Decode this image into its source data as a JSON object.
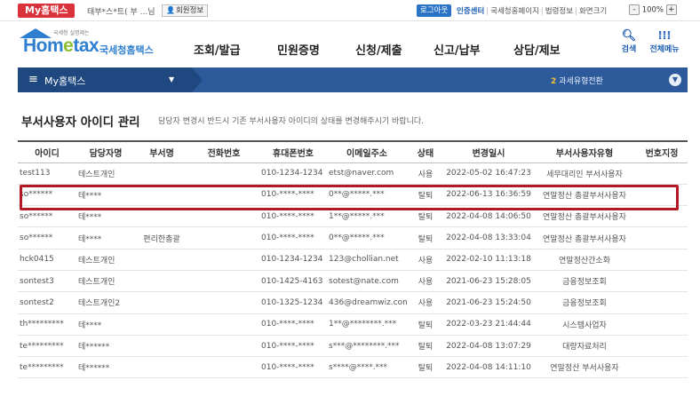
{
  "topbar": {
    "my_badge": "My홈택스",
    "username": "태부*스*트( 부 ...님",
    "profile_button": "회원정보",
    "logout_button": "로그아웃",
    "links": [
      "인증센터",
      "국세청홈페이지",
      "법령정보",
      "화면크기"
    ],
    "zoom": {
      "minus": "-",
      "value": "100%",
      "plus": "+"
    }
  },
  "logo": {
    "tagline": "국세청 실명제는",
    "wordmark_pre": "Hom",
    "wordmark_e": "e",
    "wordmark_post": "tax",
    "subtitle": "국세청홈택스"
  },
  "nav": {
    "menu": [
      "조회/발급",
      "민원증명",
      "신청/제출",
      "신고/납부",
      "상담/제보"
    ],
    "search_label": "검색",
    "allmenu_label": "전체메뉴"
  },
  "bluebar": {
    "title": "My홈택스",
    "switch_num": "2",
    "switch_label": "과세유형전환"
  },
  "page": {
    "title": "부서사용자 아이디 관리",
    "note": "담당자 변경시 반드시 기존 부서사용자 아이디의 상태를 변경해주시기 바랍니다."
  },
  "table": {
    "headers": [
      "아이디",
      "담당자명",
      "부서명",
      "전화번호",
      "휴대폰번호",
      "이메일주소",
      "상태",
      "변경일시",
      "부서사용자유형",
      "번호지정"
    ],
    "rows": [
      [
        "test113",
        "테스트개인",
        "",
        "",
        "010-1234-1234",
        "etst@naver.com",
        "사용",
        "2022-05-02 16:47:23",
        "세무대리인 부서사용자",
        ""
      ],
      [
        "so******",
        "테****",
        "",
        "",
        "010-****-****",
        "0**@*****.***",
        "탈퇴",
        "2022-06-13 16:36:59",
        "연말정산 총괄부서사용자",
        ""
      ],
      [
        "so******",
        "테****",
        "",
        "",
        "010-****-****",
        "1**@*****.***",
        "탈퇴",
        "2022-04-08 14:06:50",
        "연말정산 총괄부서사용자",
        ""
      ],
      [
        "so******",
        "테****",
        "편리한총괄",
        "",
        "010-****-****",
        "0**@*****.***",
        "탈퇴",
        "2022-04-08 13:33:04",
        "연말정산 총괄부서사용자",
        ""
      ],
      [
        "hck0415",
        "테스트개인",
        "",
        "",
        "010-1234-1234",
        "123@chollian.net",
        "사용",
        "2022-02-10 11:13:18",
        "연말정산간소화",
        ""
      ],
      [
        "sontest3",
        "테스트개인",
        "",
        "",
        "010-1425-4163",
        "sotest@nate.com",
        "사용",
        "2021-06-23 15:28:05",
        "금융정보조회",
        ""
      ],
      [
        "sontest2",
        "테스트개인2",
        "",
        "",
        "010-1325-1234",
        "436@dreamwiz.com",
        "사용",
        "2021-06-23 15:24:50",
        "금융정보조회",
        ""
      ],
      [
        "th*********",
        "테****",
        "",
        "",
        "010-****-****",
        "1**@********.***",
        "탈퇴",
        "2022-03-23 21:44:44",
        "시스템사업자",
        ""
      ],
      [
        "te*********",
        "테******",
        "",
        "",
        "010-****-****",
        "s***@********.***",
        "탈퇴",
        "2022-04-08 13:07:29",
        "대량자료처리",
        ""
      ],
      [
        "te*********",
        "테******",
        "",
        "",
        "010-****-****",
        "s****@****.***",
        "탈퇴",
        "2022-04-08 14:11:10",
        "연말정산 부서사용자",
        ""
      ]
    ]
  },
  "colors": {
    "brand_red": "#d9323b",
    "nav_blue": "#2d5a9a",
    "highlight": "#b31924"
  }
}
